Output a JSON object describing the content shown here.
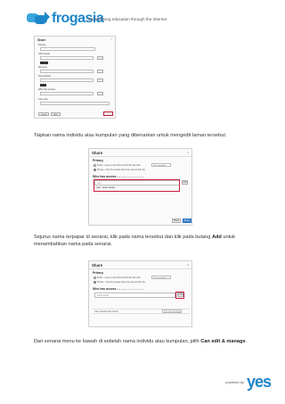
{
  "header": {
    "logo_text": "frogasia",
    "tagline": "transforming education through the Internet"
  },
  "shot1": {
    "title": "Share",
    "close": "×",
    "rows": [
      "Privacy",
      "Add people",
      "Remove",
      "Permissions",
      "Who has access",
      "Can view",
      "Can edit",
      "Full access"
    ],
    "footer": [
      "Cancel",
      "Back",
      "Share"
    ]
  },
  "captions": {
    "c1": "Taipkan nama individu atau kumpulan yang dibenarkan untuk mengedit laman tersebut.",
    "c2_pre": "Sejurus nama terpapar di senarai, klik pada nama tersebut dan klik pada butang ",
    "c2_bold": "Add",
    "c2_post": " untuk menambahkan nama pada senarai.",
    "c3_pre": "Dari senarai menu ke bawah di sebelah nama individu atau kumpulan, pilih ",
    "c3_bold": "Can edit & manage",
    "c3_post": "."
  },
  "dialog2": {
    "title": "Share",
    "close": "×",
    "privacy": "Privacy",
    "radio_public": "Public - Anyone can find and find this site with",
    "radio_private": "Private - Only the people listed can access this site",
    "perm": "Can contribute",
    "who": "Who has access",
    "who_hint": "Add people to give them access",
    "input_value": "user",
    "add": "Add",
    "suggestion": "user- Jared Danks",
    "back": "Back",
    "done": "Share"
  },
  "dialog3": {
    "title": "Share",
    "close": "×",
    "privacy": "Privacy",
    "radio_public": "Public - Anyone can find and find this site with",
    "radio_private": "Private - Only the people listed can access this site",
    "perm": "Can contribute",
    "who": "Who has access",
    "who_hint": "Add people to give them access",
    "input_value": "Jared Danks",
    "add": "Add",
    "user_row": "User: Damian Two Admin",
    "user_perm": "Can edit & manage"
  },
  "footer": {
    "powered": "powered by",
    "brand": "yes"
  },
  "colors": {
    "brand": "#1d86c8",
    "highlight": "#c41e3a",
    "done_button": "#2f77c6"
  }
}
